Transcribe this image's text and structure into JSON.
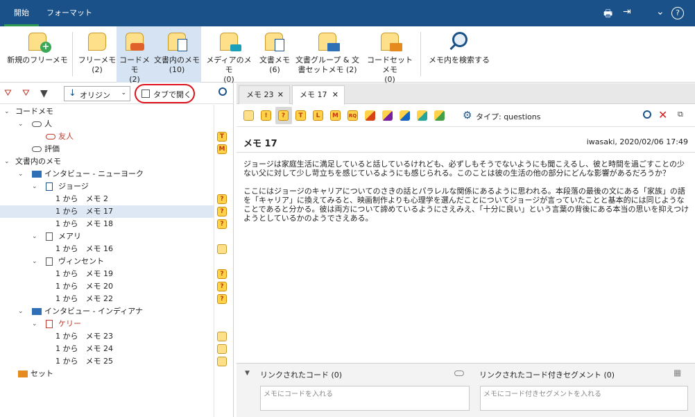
{
  "tabs": [
    {
      "label": "開始"
    },
    {
      "label": "フォーマット"
    }
  ],
  "ribbon": {
    "new_free_memo": "新規のフリーメモ",
    "free_memo": "フリーメモ",
    "free_memo_count": "(2)",
    "code_memo": "コードメモ",
    "code_memo_count": "(2)",
    "doc_inner_memo": "文書内のメモ",
    "doc_inner_memo_count": "(10)",
    "media_memo": "メディアのメモ",
    "media_memo_count": "(0)",
    "doc_memo": "文書メモ",
    "doc_memo_count": "(6)",
    "docgroup_memo_l1": "文書グループ & 文",
    "docgroup_memo_l2": "書セットメモ (2)",
    "codeset_memo": "コードセットメモ",
    "codeset_memo_count": "(0)",
    "search_memo": "メモ内を検索する"
  },
  "left_toolbar": {
    "sort_label": "オリジン",
    "open_in_tab_label": "タブで開く"
  },
  "tree": {
    "code_memo": "コードメモ",
    "person": "人",
    "friend": "友人",
    "evaluation": "評価",
    "doc_memos": "文書内のメモ",
    "interview_ny": "インタビュー - ニューヨーク",
    "george": "ジョージ",
    "m2": "1 から　メモ 2",
    "m17": "1 から　メモ 17",
    "m18": "1 から　メモ 18",
    "mary": "メアリ",
    "m16": "1 から　メモ 16",
    "vincent": "ヴィンセント",
    "m19": "1 から　メモ 19",
    "m20": "1 から　メモ 20",
    "m22": "1 から　メモ 22",
    "interview_in": "インタビュー - インディアナ",
    "kelly": "ケリー",
    "m23": "1 から　メモ 23",
    "m24": "1 から　メモ 24",
    "m25": "1 から　メモ 25",
    "set": "セット"
  },
  "badges": {
    "t": "T",
    "m": "M",
    "q": "?",
    "rq": "RQ",
    "excl": "!",
    "l": "L"
  },
  "doc_tabs": [
    {
      "label": "メモ 23"
    },
    {
      "label": "メモ 17"
    }
  ],
  "memo_toolbar": {
    "type_label": "タイプ: questions"
  },
  "memo": {
    "title": "メモ 17",
    "meta": "iwasaki, 2020/02/06 17:49",
    "p1": "ジョージは家庭生活に満足していると話しているけれども、必ずしもそうでないようにも聞こえるし、彼と時間を過ごすことの少ない父に対して少し苛立ちを感じているようにも感じられる。このことは彼の生活の他の部分にどんな影響があるだろうか？",
    "p2": "ここにはジョージのキャリアについてのさきの話とパラレルな関係にあるように思われる。本段落の最後の文にある「家族」の語を「キャリア」に換えてみると、映画制作よりも心理学を選んだことについてジョージが言っていたことと基本的には同じようなことであると分かる。彼は両方について諦めているようにさえみえ、「十分に良い」という言葉の背後にある本当の思いを抑えつけようとしているかのようでさえある。"
  },
  "bottom": {
    "linked_codes": "リンクされたコード (0)",
    "linked_segments": "リンクされたコード付きセグメント (0)",
    "code_placeholder": "メモにコードを入れる",
    "segment_placeholder": "メモにコード付きセグメントを入れる"
  },
  "colors": {
    "titlebar": "#1a5189",
    "accent": "#2e9a52",
    "highlight": "#d6e3f2",
    "memo_yellow": "#ffe08a"
  }
}
